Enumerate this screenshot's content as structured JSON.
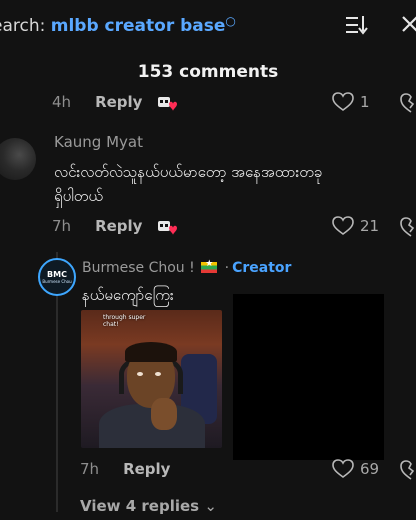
{
  "search": {
    "label": "earch:",
    "query": "mlbb creator base",
    "search_glyph": "⚲"
  },
  "comments_header": {
    "count_label": "153 comments"
  },
  "top_row": {
    "time": "4h",
    "reply_label": "Reply",
    "likes": "1"
  },
  "comment1": {
    "username": "Kaung Myat",
    "text_line1": "လင်းလတ်လဲသူနယ်ပယ်မာတော့ အနေအထားတခု",
    "text_line2": "ရှိပါတယ်",
    "time": "7h",
    "reply_label": "Reply",
    "likes": "21"
  },
  "reply1": {
    "avatar_monogram": "BMC",
    "avatar_subtitle": "Burmese Chou",
    "username": "Burmese Chou !",
    "separator": "·",
    "creator_badge": "Creator",
    "text": "နယ်မကျော်ကြေး",
    "thumb_caption_line1": "through super",
    "thumb_caption_line2": "chat!",
    "time": "7h",
    "reply_label": "Reply",
    "likes": "69"
  },
  "view_replies": {
    "label": "View 4 replies",
    "chevron": "⌄"
  },
  "colors": {
    "accent": "#4aa3ff",
    "background": "#121212",
    "react_red": "#ff2d55"
  },
  "icons": {
    "sort": "sort-icon",
    "close": "close-icon",
    "heart": "heart-icon",
    "dislike": "dislike-icon",
    "reaction": "reaction-emoji-icon"
  }
}
